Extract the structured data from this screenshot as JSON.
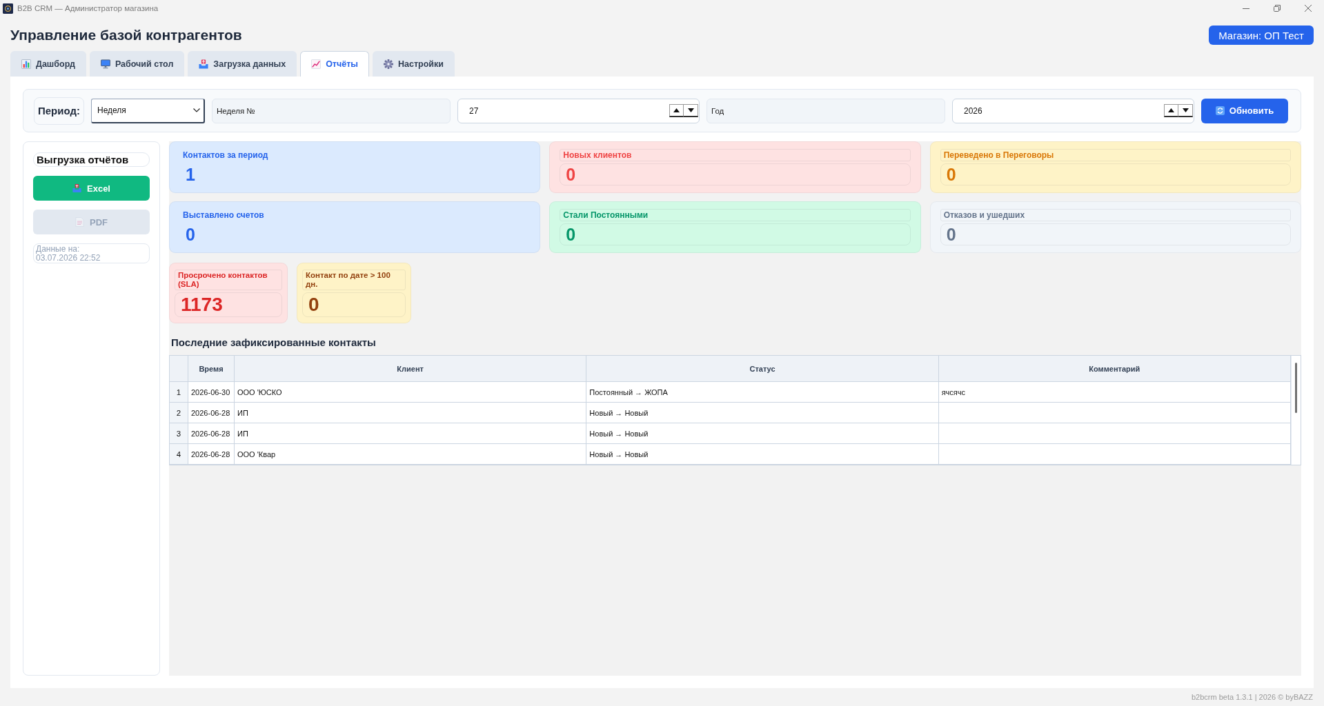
{
  "window": {
    "title": "B2B CRM — Администратор магазина"
  },
  "header": {
    "title": "Управление базой контрагентов",
    "store_button": "Магазин: ОП Тест"
  },
  "tabs": [
    {
      "kind": "dashboard",
      "label": "Дашборд",
      "selected": false
    },
    {
      "kind": "desktop",
      "label": "Рабочий стол",
      "selected": false
    },
    {
      "kind": "upload",
      "label": "Загрузка данных",
      "selected": false
    },
    {
      "kind": "reports",
      "label": "Отчёты",
      "selected": true
    },
    {
      "kind": "settings",
      "label": "Настройки",
      "selected": false
    }
  ],
  "filters": {
    "period_label": "Период:",
    "period": "Неделя",
    "week_label": "Неделя №",
    "week": "27",
    "year_label": "Год",
    "year": "2026",
    "refresh_button": "Обновить"
  },
  "export_panel": {
    "title": "Выгрузка отчётов",
    "buttons": [
      {
        "kind": "excel",
        "label": "Excel",
        "disabled": false
      },
      {
        "kind": "pdf",
        "label": "PDF",
        "disabled": true
      }
    ],
    "timestamp_label": "Данные на:",
    "timestamp": "03.07.2026 22:52"
  },
  "metrics": [
    {
      "kind": "plain",
      "label": "Контактов за период",
      "value": "1",
      "color": "#2563eb"
    },
    {
      "kind": "boxed",
      "label": "Новых клиентов",
      "value": "0",
      "color": "#ef4444"
    },
    {
      "kind": "boxed",
      "label": "Переведено в Переговоры",
      "value": "0",
      "color": "#d97706"
    },
    {
      "kind": "plain",
      "label": "Выставлено счетов",
      "value": "0",
      "color": "#2563eb"
    },
    {
      "kind": "boxed",
      "label": "Стали Постоянными",
      "value": "0",
      "color": "#059669"
    },
    {
      "kind": "boxed",
      "label": "Отказов и ушедших",
      "value": "0",
      "color": "#64748b"
    }
  ],
  "alert_metrics": [
    {
      "kind": "boxed",
      "label": "Просрочено контактов (SLA)",
      "value": "1173",
      "color": "#dc2626"
    },
    {
      "kind": "boxed",
      "label": "Контакт по дате > 100 дн.",
      "value": "0",
      "color": "#92400e"
    }
  ],
  "recent_contacts": {
    "title": "Последние зафиксированные контакты",
    "columns": [
      "Время",
      "Клиент",
      "Статус",
      "Комментарий"
    ],
    "rows": [
      {
        "number": "1",
        "time": "2026-06-30",
        "client": "ООО 'ЮСКО",
        "status": "Постоянный → ЖОПА",
        "comment": "ячсячс"
      },
      {
        "number": "2",
        "time": "2026-06-28",
        "client": "ИП",
        "status": "Новый → Новый"
      },
      {
        "number": "3",
        "time": "2026-06-28",
        "client": "ИП",
        "status": "Новый → Новый"
      },
      {
        "number": "4",
        "time": "2026-06-28",
        "client": "ООО 'Квар",
        "status": "Новый → Новый"
      }
    ]
  },
  "footer": "b2bcrm beta 1.3.1 | 2026 © byBAZZ"
}
